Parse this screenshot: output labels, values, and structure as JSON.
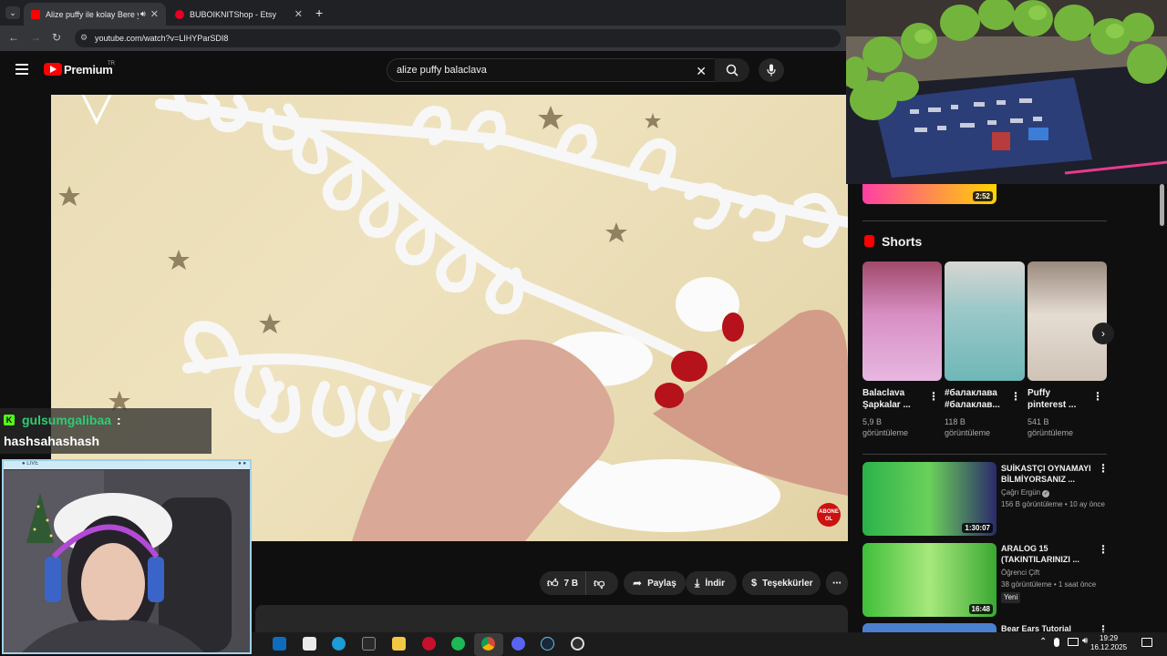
{
  "browser": {
    "tabs": [
      {
        "title": "Alize puffy ile kolay Bere y",
        "active": true
      },
      {
        "title": "BUBOIKNITShop - Etsy",
        "active": false
      }
    ],
    "url": "youtube.com/watch?v=LIHYParSDI8"
  },
  "youtube": {
    "logo_text": "Premium",
    "logo_badge": "TR",
    "search_value": "alize puffy balaclava"
  },
  "video": {
    "subscribe_overlay": "ABONE OL"
  },
  "actions": {
    "likes": "7 B",
    "share": "Paylaş",
    "download": "İndir",
    "thanks": "Teşekkürler"
  },
  "sidebar": {
    "top_duration": "2:52",
    "shorts_heading": "Shorts",
    "shorts": [
      {
        "title_line1": "Balaclava",
        "title_line2": "Şapkalar ...",
        "views": "5,9 B",
        "views_label": "görüntüleme"
      },
      {
        "title_line1": "#балаклава",
        "title_line2": "#балаклав...",
        "views": "118 B",
        "views_label": "görüntüleme"
      },
      {
        "title_line1": "Puffy",
        "title_line2": "pinterest ...",
        "views": "541 B",
        "views_label": "görüntüleme"
      }
    ],
    "videos": [
      {
        "title_line1": "SUİKASTÇI OYNAMAYI",
        "title_line2": "BİLMİYORSANIZ ...",
        "channel": "Çağrı Ergün",
        "meta": "156 B görüntüleme • 10 ay önce",
        "duration": "1:30:07",
        "badge": ""
      },
      {
        "title_line1": "ARALOG 15",
        "title_line2": "(TAKINTILARINIZI ...",
        "channel": "Öğrenci Çift",
        "meta": "38 görüntüleme • 1 saat önce",
        "duration": "16:48",
        "badge": "Yeni"
      },
      {
        "title_line1": "Bear Ears Tutorial",
        "title_line2": "",
        "channel": "",
        "meta": "",
        "duration": "",
        "badge": ""
      }
    ]
  },
  "chat": {
    "username": "gulsumgalibaa",
    "separator": ":",
    "message": "hashsahashash"
  },
  "stream": {
    "live_label": "● LIVE"
  },
  "taskbar": {
    "time": "19:29",
    "date": "16.12.2025"
  },
  "colors": {
    "youtube_red": "#ff0000",
    "chat_user_green": "#2ecc71",
    "background": "#0f0f0f"
  }
}
